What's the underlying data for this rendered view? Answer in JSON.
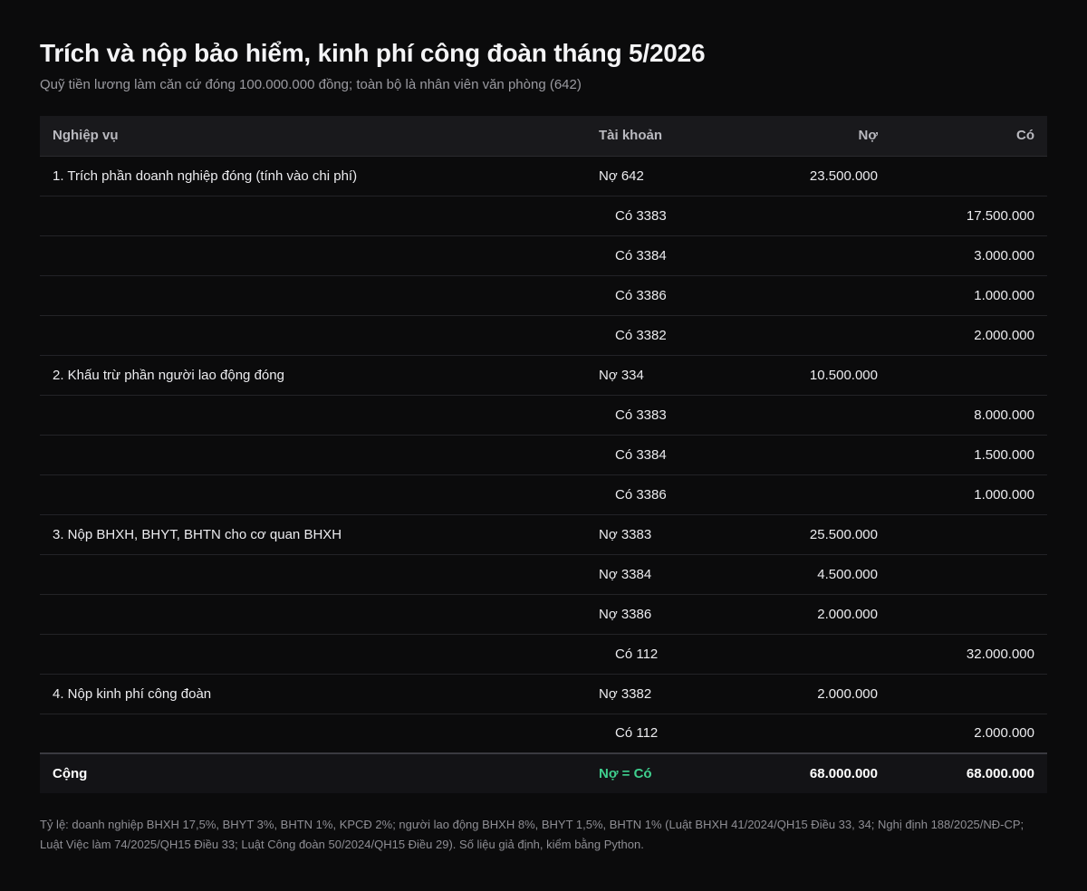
{
  "header": {
    "title": "Trích và nộp bảo hiểm, kinh phí công đoàn tháng 5/2026",
    "subtitle": "Quỹ tiền lương làm căn cứ đóng 100.000.000 đồng; toàn bộ là nhân viên văn phòng (642)"
  },
  "table": {
    "columns": {
      "description": "Nghiệp vụ",
      "account": "Tài khoản",
      "debit": "Nợ",
      "credit": "Có"
    },
    "rows": [
      {
        "description": "1. Trích phần doanh nghiệp đóng (tính vào chi phí)",
        "side": "debit",
        "account": "Nợ 642",
        "debit": "23.500.000",
        "credit": ""
      },
      {
        "description": "",
        "side": "credit",
        "account": "Có 3383",
        "debit": "",
        "credit": "17.500.000"
      },
      {
        "description": "",
        "side": "credit",
        "account": "Có 3384",
        "debit": "",
        "credit": "3.000.000"
      },
      {
        "description": "",
        "side": "credit",
        "account": "Có 3386",
        "debit": "",
        "credit": "1.000.000"
      },
      {
        "description": "",
        "side": "credit",
        "account": "Có 3382",
        "debit": "",
        "credit": "2.000.000"
      },
      {
        "description": "2. Khấu trừ phần người lao động đóng",
        "side": "debit",
        "account": "Nợ 334",
        "debit": "10.500.000",
        "credit": ""
      },
      {
        "description": "",
        "side": "credit",
        "account": "Có 3383",
        "debit": "",
        "credit": "8.000.000"
      },
      {
        "description": "",
        "side": "credit",
        "account": "Có 3384",
        "debit": "",
        "credit": "1.500.000"
      },
      {
        "description": "",
        "side": "credit",
        "account": "Có 3386",
        "debit": "",
        "credit": "1.000.000"
      },
      {
        "description": "3. Nộp BHXH, BHYT, BHTN cho cơ quan BHXH",
        "side": "debit",
        "account": "Nợ 3383",
        "debit": "25.500.000",
        "credit": ""
      },
      {
        "description": "",
        "side": "debit",
        "account": "Nợ 3384",
        "debit": "4.500.000",
        "credit": ""
      },
      {
        "description": "",
        "side": "debit",
        "account": "Nợ 3386",
        "debit": "2.000.000",
        "credit": ""
      },
      {
        "description": "",
        "side": "credit",
        "account": "Có 112",
        "debit": "",
        "credit": "32.000.000"
      },
      {
        "description": "4. Nộp kinh phí công đoàn",
        "side": "debit",
        "account": "Nợ 3382",
        "debit": "2.000.000",
        "credit": ""
      },
      {
        "description": "",
        "side": "credit",
        "account": "Có 112",
        "debit": "",
        "credit": "2.000.000"
      }
    ],
    "total": {
      "label": "Cộng",
      "balance": "Nợ = Có",
      "debit": "68.000.000",
      "credit": "68.000.000"
    }
  },
  "footnote": "Tỷ lệ: doanh nghiệp BHXH 17,5%, BHYT 3%, BHTN 1%, KPCĐ 2%; người lao động BHXH 8%, BHYT 1,5%, BHTN 1% (Luật BHXH 41/2024/QH15 Điều 33, 34; Nghị định 188/2025/NĐ-CP; Luật Việc làm 74/2025/QH15 Điều 33; Luật Công đoàn 50/2024/QH15 Điều 29). Số liệu giả định, kiểm bằng Python.",
  "colors": {
    "debit_account": "#6f9dff",
    "credit_account": "#f5a25d",
    "balance_ok": "#3fcf8e",
    "background": "#0b0b0c"
  }
}
